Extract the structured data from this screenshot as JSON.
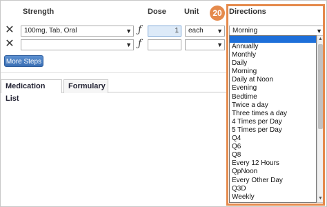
{
  "header": {
    "strength": "Strength",
    "dose": "Dose",
    "unit": "Unit",
    "directions": "Directions"
  },
  "step_badge": "20",
  "rows": [
    {
      "strength": "100mg, Tab, Oral",
      "dose": "1",
      "unit": "each",
      "directions": "Morning"
    },
    {
      "strength": "",
      "dose": "",
      "unit": "",
      "directions": ""
    }
  ],
  "icons": {
    "remove": "close-icon",
    "formula": "fx-icon",
    "dropdown": "chevron-down-icon"
  },
  "buttons": {
    "more_steps": "More Steps"
  },
  "tabs": [
    {
      "label": "Medication List"
    },
    {
      "label": "Formulary"
    }
  ],
  "directions_options": [
    "",
    "Annually",
    "Monthly",
    "Daily",
    "Morning",
    "Daily at Noon",
    "Evening",
    "Bedtime",
    "Twice a day",
    "Three times a day",
    "4 Times per Day",
    "5 Times per Day",
    "Q4",
    "Q6",
    "Q8",
    "Every 12 Hours",
    "QpNoon",
    "Every Other Day",
    "Q3D",
    "Weekly"
  ],
  "colors": {
    "highlight": "#e58a4c",
    "selected_option": "#1e6fd9",
    "button": "#3a6fb4"
  }
}
